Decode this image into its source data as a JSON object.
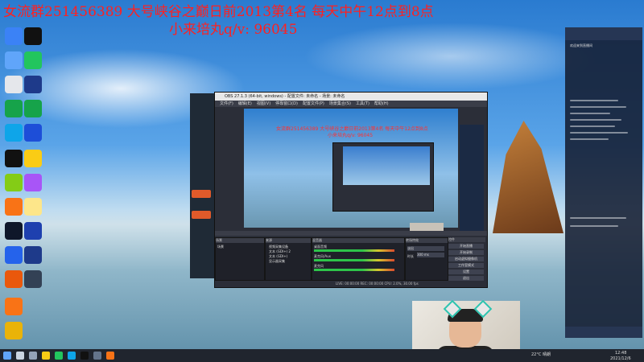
{
  "overlay": {
    "line1": "女流群251456389 大号峡谷之巅日前2013第4名 每天中午12点到8点",
    "line2": "小来培丸q/v:  96045"
  },
  "obs": {
    "title": "OBS 27.1.3 (64-bit, windows) - 配置文件: 未命名 - 场景: 未命名",
    "menu": [
      "文件(F)",
      "编辑(E)",
      "视图(V)",
      "停靠窗口(D)",
      "配置文件(P)",
      "场景集合(S)",
      "工具(T)",
      "帮助(H)"
    ],
    "panels": {
      "scenes_header": "场景",
      "sources_header": "来源",
      "mixer_header": "混音器",
      "transitions_header": "转场特效",
      "controls_header": "控件"
    },
    "scene_item": "场景",
    "sources": [
      "视频采集设备",
      "文本 (GDI+) 2",
      "文本 (GDI+)",
      "显示器采集"
    ],
    "mixer_items": [
      "桌面音频",
      "麦克风/Aux",
      "麦克风"
    ],
    "transition_value": "淡出",
    "duration_label": "时长",
    "duration_value": "300 ms",
    "controls": [
      "开始直播",
      "开始录制",
      "启动虚拟摄像机",
      "工作室模式",
      "设置",
      "退出"
    ],
    "status": "LIVE: 00:00:00   REC: 00:00:00   CPU: 2.0%, 30.00 fps",
    "preview_text1": "女流群251456389 大号峡谷之巅日前2013第4名 每天中午12点到8点",
    "preview_text2": "小来培丸q/v: 96045"
  },
  "chat": {
    "notice": "欢迎来到直播间"
  },
  "taskbar": {
    "weather": "22°C 晴朗",
    "time": "12:48",
    "date": "2021/12/6"
  },
  "colors": {
    "overlay_text": "#ff2020",
    "obs_bg": "#2b2e38",
    "taskbar": "#20252e"
  }
}
